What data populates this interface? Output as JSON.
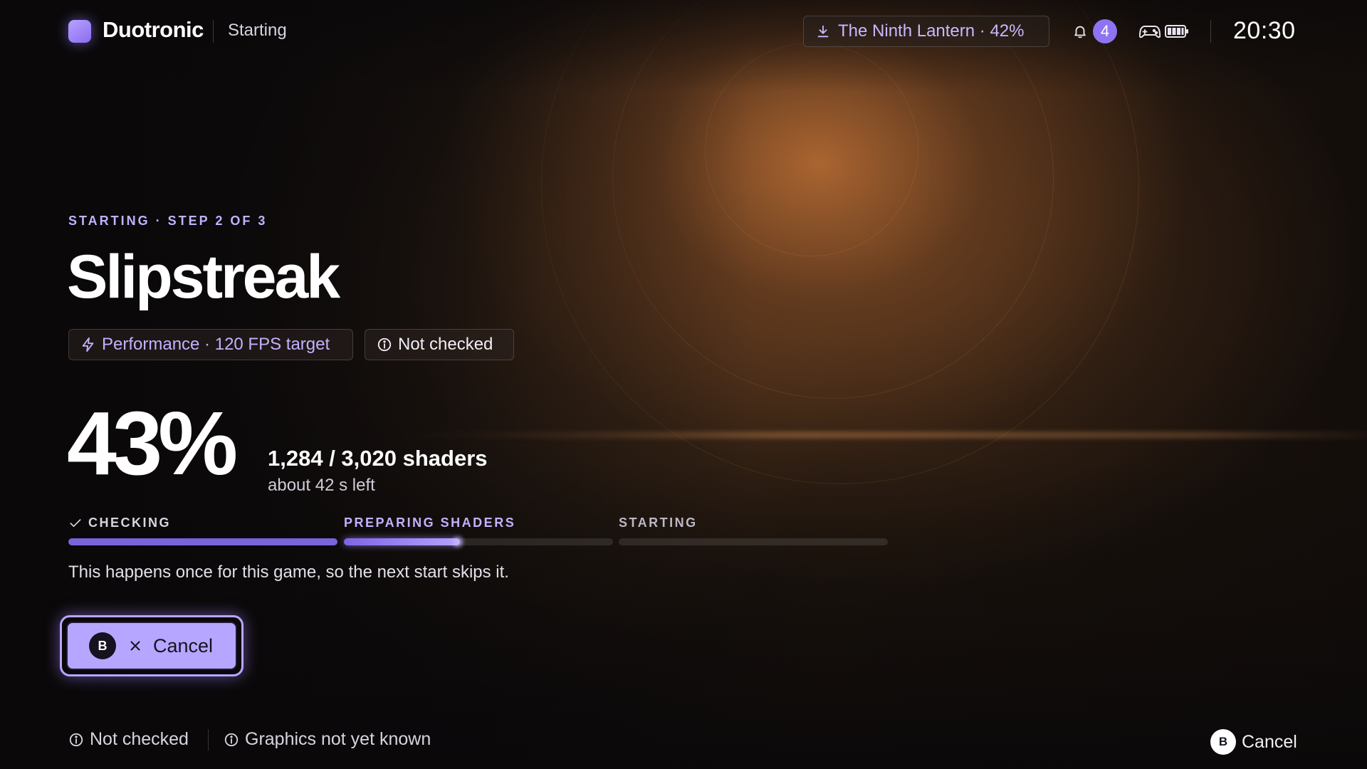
{
  "header": {
    "brand": "Duotronic",
    "context": "Starting",
    "download": "The Ninth Lantern · 42%",
    "notification_count": "4",
    "clock": "20:30"
  },
  "launch": {
    "eyebrow": "STARTING · STEP 2 OF 3",
    "title": "Slipstreak",
    "performance_chip": "Performance · 120 FPS target",
    "check_chip": "Not checked",
    "percent": "43%",
    "shader_count": "1,284 / 3,020 shaders",
    "time_left": "about 42 s left",
    "steps": [
      {
        "label": "CHECKING",
        "state": "done",
        "progress": 1.0
      },
      {
        "label": "PREPARING SHADERS",
        "state": "active",
        "progress": 0.43
      },
      {
        "label": "STARTING",
        "state": "pending",
        "progress": 0
      }
    ],
    "note": "This happens once for this game, so the next start skips it.",
    "cancel_button": {
      "glyph": "B",
      "label": "Cancel"
    }
  },
  "footer": {
    "status_1": "Not checked",
    "status_2": "Graphics not yet known",
    "action_glyph": "B",
    "action_label": "Cancel"
  },
  "colors": {
    "accent": "#b7a6ff",
    "accent_dark": "#7b63dc",
    "badge": "#8e73f2",
    "background": "#0d0b0c"
  },
  "icons": [
    "download-icon",
    "bell-icon",
    "gamepad-icon",
    "battery-icon",
    "bolt-icon",
    "info-icon",
    "check-icon",
    "close-icon"
  ]
}
